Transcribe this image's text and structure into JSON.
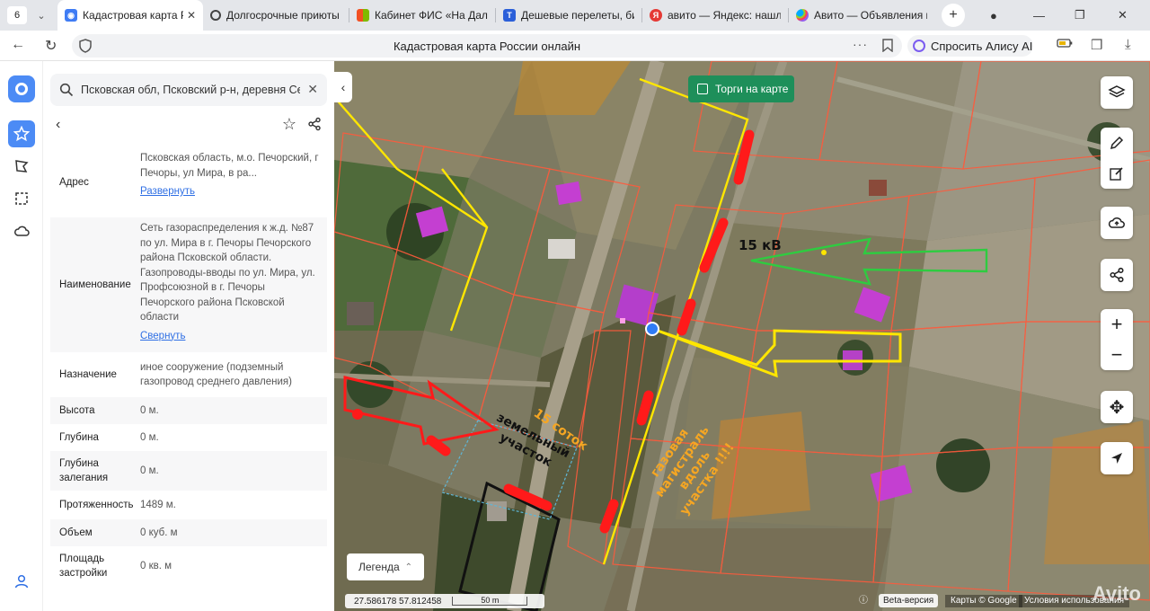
{
  "browser": {
    "tab_count": "6",
    "tabs": [
      {
        "title": "Кадастровая карта Ро",
        "icon": "kadastr-icon",
        "color": "#3f7cf4",
        "active": true
      },
      {
        "title": "Долгосрочные приюты д",
        "icon": "alisa-ring-icon",
        "color": "#444444",
        "active": false
      },
      {
        "title": "Кабинет ФИС «На Даль",
        "icon": "windows-icon",
        "color": "#f25022",
        "active": false
      },
      {
        "title": "Дешевые перелеты, бил",
        "icon": "travel-t-icon",
        "color": "#2b5fd9",
        "active": false
      },
      {
        "title": "авито — Яндекс: нашлос",
        "icon": "yandex-icon",
        "color": "#e53935",
        "active": false
      },
      {
        "title": "Авито — Объявления на",
        "icon": "avito-icon",
        "color": "#00aaff",
        "active": false
      }
    ],
    "page_title": "Кадастровая карта России онлайн",
    "alice_label": "Спросить Алису AI"
  },
  "panel": {
    "search_text": "Псковская обл, Псковский р-н, деревня Севе",
    "rows": [
      {
        "label": "Адрес",
        "value": "Псковская область, м.о. Печорский, г Печоры, ул Мира, в ра...",
        "link": "Развернуть"
      },
      {
        "label": "Наименование",
        "value": "Сеть газораспределения к ж.д. №87 по ул. Мира в г. Печоры Печорского района Псковской области. Газопроводы-вводы по ул. Мира, ул. Профсоюзной в г. Печоры Печорского района Псковской области",
        "link": "Свернуть"
      },
      {
        "label": "Назначение",
        "value": "иное сооружение (подземный газопровод среднего давления)"
      },
      {
        "label": "Высота",
        "value": "0 м."
      },
      {
        "label": "Глубина",
        "value": "0 м."
      },
      {
        "label": "Глубина залегания",
        "value": "0 м."
      },
      {
        "label": "Протяженность",
        "value": "1489 м."
      },
      {
        "label": "Объем",
        "value": "0 куб. м"
      },
      {
        "label": "Площадь застройки",
        "value": "0  кв. м"
      }
    ]
  },
  "map": {
    "torgi_label": "Торги на карте",
    "legend_label": "Легенда",
    "coords": "27.586178  57.812458",
    "scale_label": "50 m",
    "beta_label": "Beta-версия",
    "attribution_1": "Карты © Google",
    "attribution_2": "Условия использования",
    "watermark": "Avito",
    "annotations": {
      "kv": "15 кВ",
      "sotok": "15 соток",
      "plot": "земельный\nучасток",
      "gas": "газовая\nмагистраль\nвдоль\nучастка !!!!"
    },
    "colors": {
      "accent": "#4c8bf5",
      "torgi_green": "#1e8f5a",
      "boundary": "#ff5a3c",
      "yellow": "#ffe600",
      "red": "#ff1a1a",
      "green": "#2ecc40"
    }
  }
}
